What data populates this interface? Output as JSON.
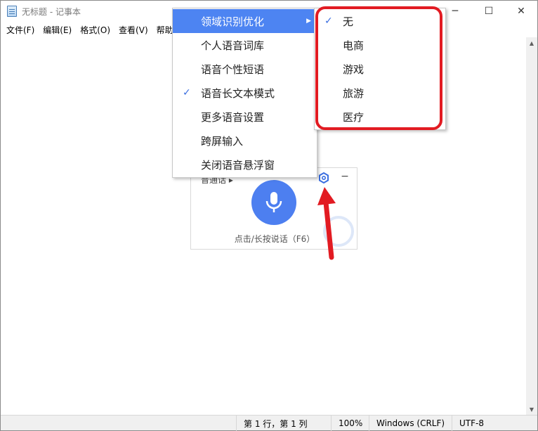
{
  "window": {
    "title": "无标题 - 记事本",
    "minimize": "─",
    "maximize": "☐",
    "close": "✕"
  },
  "menubar": {
    "items": [
      "文件(F)",
      "编辑(E)",
      "格式(O)",
      "查看(V)",
      "帮助"
    ]
  },
  "context_menu": {
    "items": [
      {
        "label": "领域识别优化",
        "checked": false,
        "has_submenu": true,
        "highlighted": true
      },
      {
        "label": "个人语音词库",
        "checked": false
      },
      {
        "label": "语音个性短语",
        "checked": false
      },
      {
        "label": "语音长文本模式",
        "checked": true
      },
      {
        "label": "更多语音设置",
        "checked": false
      },
      {
        "label": "跨屏输入",
        "checked": false
      },
      {
        "label": "关闭语音悬浮窗",
        "checked": false
      }
    ]
  },
  "submenu": {
    "items": [
      {
        "label": "无",
        "checked": true
      },
      {
        "label": "电商",
        "checked": false
      },
      {
        "label": "游戏",
        "checked": false
      },
      {
        "label": "旅游",
        "checked": false
      },
      {
        "label": "医疗",
        "checked": false
      }
    ]
  },
  "voice_widget": {
    "language": "普通话 ▸",
    "hint": "点击/长按说话（F6）",
    "logo": "FLY",
    "minimize": "−"
  },
  "statusbar": {
    "position": "第 1 行，第 1 列",
    "zoom": "100%",
    "line_ending": "Windows (CRLF)",
    "encoding": "UTF-8"
  },
  "colors": {
    "accent": "#4d84f2",
    "highlight_box": "#e21b22",
    "mic_button": "#4d7ff0"
  }
}
